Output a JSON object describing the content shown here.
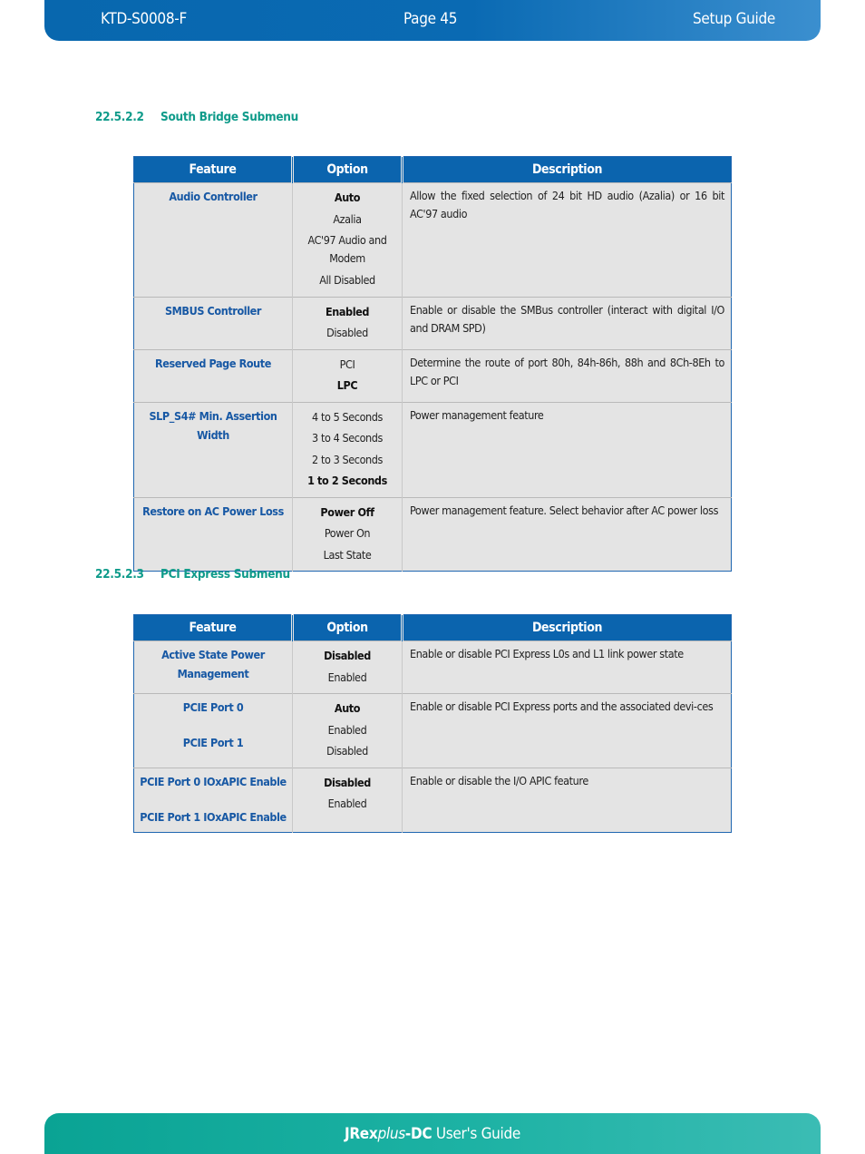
{
  "header": {
    "doc_id": "KTD-S0008-F",
    "page": "Page 45",
    "section": "Setup Guide"
  },
  "footer": {
    "product_bold": "JRex",
    "product_italic": "plus",
    "product_suffix": "-DC",
    "rest": " User's Guide"
  },
  "sections": [
    {
      "number": "22.5.2.2",
      "title": "South Bridge Submenu",
      "columns": [
        "Feature",
        "Option",
        "Description"
      ],
      "rows": [
        {
          "feature": [
            "Audio Controller"
          ],
          "options": [
            {
              "label": "Auto",
              "default": true
            },
            {
              "label": "Azalia"
            },
            {
              "label": "AC'97 Audio and Modem"
            },
            {
              "label": "All Disabled"
            }
          ],
          "description": "Allow the fixed selection of 24 bit HD audio (Azalia) or 16 bit AC'97 audio"
        },
        {
          "feature": [
            "SMBUS Controller"
          ],
          "options": [
            {
              "label": "Enabled",
              "default": true
            },
            {
              "label": "Disabled"
            }
          ],
          "description": "Enable or disable the SMBus controller (interact with digital I/O and DRAM SPD)"
        },
        {
          "feature": [
            "Reserved Page Route"
          ],
          "options": [
            {
              "label": "PCI"
            },
            {
              "label": "LPC",
              "default": true
            }
          ],
          "description": "Determine the route of port 80h, 84h-86h, 88h and 8Ch-8Eh to LPC or PCI"
        },
        {
          "feature": [
            "SLP_S4# Min. Assertion Width"
          ],
          "options": [
            {
              "label": "4 to 5 Seconds"
            },
            {
              "label": "3 to 4 Seconds"
            },
            {
              "label": "2 to 3 Seconds"
            },
            {
              "label": "1 to 2 Seconds",
              "default": true
            }
          ],
          "description": "Power management feature"
        },
        {
          "feature": [
            "Restore on AC Power Loss"
          ],
          "options": [
            {
              "label": "Power Off",
              "default": true
            },
            {
              "label": "Power On"
            },
            {
              "label": "Last State"
            }
          ],
          "description": "Power management feature. Select behavior after AC power loss"
        }
      ]
    },
    {
      "number": "22.5.2.3",
      "title": "PCI Express Submenu",
      "columns": [
        "Feature",
        "Option",
        "Description"
      ],
      "rows": [
        {
          "feature": [
            "Active State Power Management"
          ],
          "options": [
            {
              "label": "Disabled",
              "default": true
            },
            {
              "label": "Enabled"
            }
          ],
          "description": "Enable or disable PCI Express L0s and L1 link power state"
        },
        {
          "feature": [
            "PCIE Port 0",
            "PCIE Port 1"
          ],
          "options": [
            {
              "label": "Auto",
              "default": true
            },
            {
              "label": "Enabled"
            },
            {
              "label": "Disabled"
            }
          ],
          "description": "Enable or disable PCI Express ports and the associated devi-ces"
        },
        {
          "feature": [
            "PCIE Port 0 IOxAPIC Enable",
            "PCIE Port 1 IOxAPIC Enable"
          ],
          "options": [
            {
              "label": "Disabled",
              "default": true
            },
            {
              "label": "Enabled"
            }
          ],
          "description": "Enable or disable the I/O APIC feature"
        }
      ]
    }
  ]
}
